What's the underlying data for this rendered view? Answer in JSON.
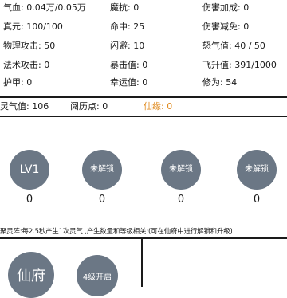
{
  "stats": {
    "qixue": "气血: 0.04万/0.05万",
    "mokang": "魔抗: 0",
    "shanghai_jiacheng": "伤害加成: 0",
    "zhenyuan": "真元: 100/100",
    "mingzhong": "命中: 25",
    "shanghai_jianmian": "伤害减免: 0",
    "wuli_gongji": "物理攻击: 50",
    "shanbi": "闪避: 10",
    "nuqi": "怒气值: 40 / 50",
    "fashu_gongji": "法术攻击: 0",
    "baoji": "暴击值: 0",
    "feisheng": "飞升值: 391/1000",
    "hujia": "护甲: 0",
    "xingyun": "幸运值: 0",
    "xiuwei": "修为: 54"
  },
  "resources": {
    "lingqi": "灵气值: 106",
    "yuelidian": "阅历点: 0",
    "xianyuan": "仙缘: 0"
  },
  "slots": [
    {
      "label": "LV1",
      "count": "0"
    },
    {
      "label": "未解锁",
      "count": "0"
    },
    {
      "label": "未解锁",
      "count": "0"
    },
    {
      "label": "未解锁",
      "count": "0"
    }
  ],
  "description": "聚灵阵:每2.5秒产生1次灵气 ,产生数量和等级相关;(可在仙府中进行解锁和升级)",
  "buttons": {
    "xianfu": "仙府",
    "level4_unlock": "4级开启"
  },
  "colors": {
    "slot_bg": "#6b7785",
    "xianyuan_text": "#e08a1e"
  }
}
